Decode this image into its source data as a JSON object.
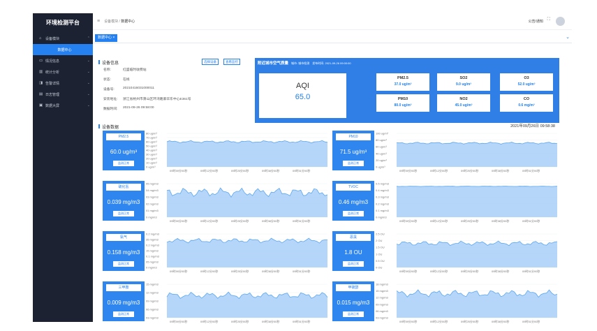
{
  "sidebar": {
    "brand": "环境检测平台",
    "items": [
      {
        "label": "设备模块",
        "icon": "home-icon",
        "open": true
      },
      {
        "label": "数据中心",
        "active": true
      },
      {
        "label": "情况信息",
        "icon": "chat-icon"
      },
      {
        "label": "统计分析",
        "icon": "chart-icon"
      },
      {
        "label": "告警详情",
        "icon": "alert-icon"
      },
      {
        "label": "日志管理",
        "icon": "document-icon"
      },
      {
        "label": "数据大屏",
        "icon": "screen-icon"
      }
    ]
  },
  "topbar": {
    "breadcrumb_parent": "设备模块",
    "breadcrumb_sep": "/",
    "breadcrumb_current": "数据中心",
    "notice": "公告/通知"
  },
  "tabs": {
    "active": "数据中心",
    "close": "×"
  },
  "device": {
    "section_title": "设备信息",
    "select_button": "选择设备",
    "track_button": "查看监控",
    "rows": [
      {
        "key": "名称:",
        "value": "红盛临时收费站"
      },
      {
        "key": "状态:",
        "value": "在线"
      },
      {
        "key": "设备号:",
        "value": "20210416031000011"
      },
      {
        "key": "安装地址:",
        "value": "浙江省杭州市萧山区环湾路紫华东中心E361号"
      },
      {
        "key": "数据时间:",
        "value": "2021-09-26 09:58:00"
      }
    ]
  },
  "aqi": {
    "title": "附近城市空气质量",
    "city": "城市: 城市检测",
    "time": "发布时间: 2021-09-26 09:00:00",
    "label": "AQI",
    "value": "65.0",
    "pollutants": [
      {
        "name": "PM2.5",
        "value": "37.0 ug/m³"
      },
      {
        "name": "SO2",
        "value": "9.0 ug/m³"
      },
      {
        "name": "O3",
        "value": "52.0 ug/m³"
      },
      {
        "name": "PM10",
        "value": "80.0 ug/m³"
      },
      {
        "name": "NO2",
        "value": "45.0 ug/m³"
      },
      {
        "name": "CO",
        "value": "0.6 mg/m³"
      }
    ]
  },
  "data_section": {
    "title": "设备数据",
    "timestamp": "2021年09月26日 09:58:38"
  },
  "x_ticks": [
    "09时59分00秒",
    "09时12分00秒",
    "09时25分00秒",
    "09时38分00秒",
    "09时51分00秒"
  ],
  "colors": {
    "accent": "#2581ef",
    "sidebar": "#1c2232",
    "area": "#a8cff7",
    "line": "#5aa6f0"
  },
  "sensors": [
    {
      "name": "PM2.5",
      "value": "60.0 ug/m³",
      "status": "监测正常",
      "yticks": [
        "80 ug/m³",
        "70 ug/m³",
        "60 ug/m³",
        "50 ug/m³",
        "40 ug/m³",
        "30 ug/m³",
        "20 ug/m³",
        "10 ug/m³",
        "0 ug/m³"
      ],
      "ymax": 80,
      "base": 60,
      "amp": 3
    },
    {
      "name": "PM10",
      "value": "71.5 ug/m³",
      "status": "监测正常",
      "yticks": [
        "100 ug/m³",
        "80 ug/m³",
        "60 ug/m³",
        "40 ug/m³",
        "20 ug/m³",
        "0 ug/m³"
      ],
      "ymax": 100,
      "base": 71,
      "amp": 3
    },
    {
      "name": "硫化氢",
      "value": "0.039 mg/m3",
      "status": "监测正常",
      "yticks": [
        "05 mg/m3",
        "04 mg/m3",
        "03 mg/m3",
        "02 mg/m3",
        "01 mg/m3",
        "0 mg/m3"
      ],
      "ymax": 0.05,
      "base": 0.037,
      "amp": 0.007
    },
    {
      "name": "TVOC",
      "value": "0.46 mg/m3",
      "status": "监测正常",
      "yticks": [
        "0.5 mg/m3",
        "0.4 mg/m3",
        "0.3 mg/m3",
        "0.2 mg/m3",
        "0.1 mg/m3",
        "0 mg/m3"
      ],
      "ymax": 0.5,
      "base": 0.46,
      "amp": 0.003
    },
    {
      "name": "氨气",
      "value": "0.158 mg/m3",
      "status": "监测正常",
      "yticks": [
        "0.2 mg/m3",
        "35 mg/m3",
        "0.2 mg/m3",
        "15 mg/m3",
        "0.1 mg/m3",
        "05 mg/m3",
        "0 mg/m3"
      ],
      "ymax": 0.2,
      "base": 0.16,
      "amp": 0.015
    },
    {
      "name": "恶臭",
      "value": "1.8 OU",
      "status": "监测正常",
      "yticks": [
        "2.5 OU",
        "2 OU",
        "1.5 OU",
        "1 OU",
        "0.5 OU",
        "0 OU"
      ],
      "ymax": 2.5,
      "base": 1.8,
      "amp": 0.18
    },
    {
      "name": "三甲胺",
      "value": "0.009 mg/m3",
      "status": "监测正常",
      "yticks": [
        "15 mg/m3",
        "12 mg/m3",
        "09 mg/m3",
        "06 mg/m3",
        "03 mg/m3"
      ],
      "ymax": 0.015,
      "base": 0.01,
      "amp": 0.0015
    },
    {
      "name": "甲硫醇",
      "value": "0.015 mg/m3",
      "status": "监测正常",
      "yticks": [
        "18 mg/m3",
        "15 mg/m3",
        "12 mg/m3",
        "09 mg/m3",
        "06 mg/m3",
        "03 mg/m3"
      ],
      "ymax": 0.018,
      "base": 0.013,
      "amp": 0.002
    }
  ]
}
